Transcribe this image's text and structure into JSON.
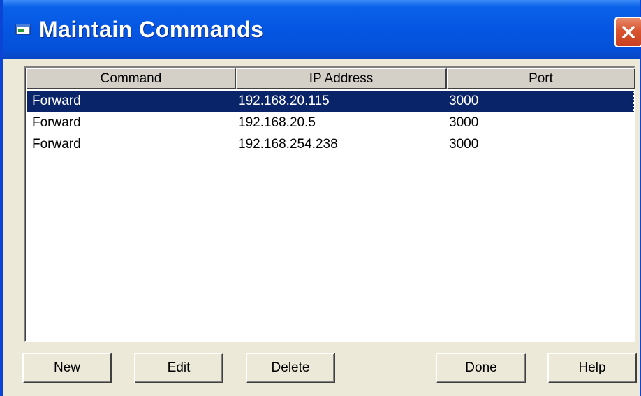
{
  "window": {
    "title": "Maintain Commands",
    "icon": "window-app-icon",
    "close_icon": "close-icon"
  },
  "table": {
    "columns": [
      "Command",
      "IP Address",
      "Port"
    ],
    "rows": [
      {
        "command": "Forward",
        "ip": "192.168.20.115",
        "port": "3000",
        "selected": true
      },
      {
        "command": "Forward",
        "ip": "192.168.20.5",
        "port": "3000",
        "selected": false
      },
      {
        "command": "Forward",
        "ip": "192.168.254.238",
        "port": "3000",
        "selected": false
      }
    ]
  },
  "buttons": {
    "new": "New",
    "edit": "Edit",
    "delete": "Delete",
    "done": "Done",
    "help": "Help"
  },
  "colors": {
    "titlebar": "#0556E3",
    "selection": "#0A246A",
    "face": "#ECE9D8",
    "close": "#D8532F"
  }
}
